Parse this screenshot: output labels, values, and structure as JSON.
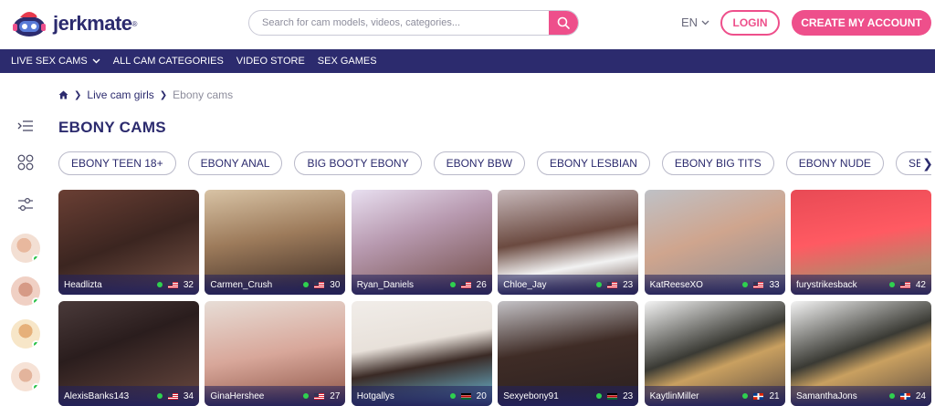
{
  "brand": {
    "name": "jerkmate",
    "reg": "®"
  },
  "search": {
    "placeholder": "Search for cam models, videos, categories..."
  },
  "language": {
    "label": "EN"
  },
  "auth": {
    "login_label": "LOGIN",
    "create_label": "CREATE MY ACCOUNT"
  },
  "nav": {
    "items": [
      {
        "label": "LIVE SEX CAMS",
        "has_dropdown": true
      },
      {
        "label": "ALL CAM CATEGORIES"
      },
      {
        "label": "VIDEO STORE"
      },
      {
        "label": "SEX GAMES"
      }
    ]
  },
  "breadcrumb": {
    "link": "Live cam girls",
    "current": "Ebony cams"
  },
  "page": {
    "title": "EBONY CAMS"
  },
  "chips": [
    "EBONY TEEN 18+",
    "EBONY ANAL",
    "BIG BOOTY EBONY",
    "EBONY BBW",
    "EBONY LESBIAN",
    "EBONY BIG TITS",
    "EBONY NUDE",
    "SEXY EBONY"
  ],
  "sidebar": {
    "icons": [
      "menu-collapse-icon",
      "grid-icon",
      "filter-sliders-icon"
    ]
  },
  "models": [
    {
      "name": "Headlizta",
      "age": "32",
      "flag": "us"
    },
    {
      "name": "Carmen_Crush",
      "age": "30",
      "flag": "us"
    },
    {
      "name": "Ryan_Daniels",
      "age": "26",
      "flag": "us"
    },
    {
      "name": "Chloe_Jay",
      "age": "23",
      "flag": "us"
    },
    {
      "name": "KatReeseXO",
      "age": "33",
      "flag": "us"
    },
    {
      "name": "furystrikesback",
      "age": "42",
      "flag": "us"
    },
    {
      "name": "AlexisBanks143",
      "age": "34",
      "flag": "us"
    },
    {
      "name": "GinaHershee",
      "age": "27",
      "flag": "us"
    },
    {
      "name": "Hotgallys",
      "age": "20",
      "flag": "ke"
    },
    {
      "name": "Sexyebony91",
      "age": "23",
      "flag": "ke"
    },
    {
      "name": "KaytlinMiller",
      "age": "21",
      "flag": "do"
    },
    {
      "name": "SamanthaJons",
      "age": "24",
      "flag": "do"
    }
  ],
  "colors": {
    "brand_pink": "#ee4f8b",
    "nav_navy": "#2c2b6e",
    "online_green": "#2fd14f"
  }
}
